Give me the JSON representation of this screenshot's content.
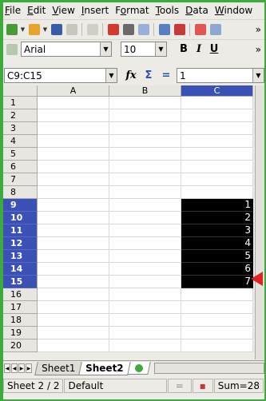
{
  "menubar": {
    "items": [
      "File",
      "Edit",
      "View",
      "Insert",
      "Format",
      "Tools",
      "Data",
      "Window"
    ],
    "mnemonics": [
      "F",
      "E",
      "V",
      "I",
      "o",
      "T",
      "D",
      "W"
    ]
  },
  "toolbar1": {
    "icons": [
      "new-document-icon",
      "open-folder-icon",
      "save-icon",
      "email-icon",
      "edit-file-icon",
      "export-pdf-icon",
      "print-icon",
      "page-preview-icon",
      "spellcheck-icon",
      "autospellcheck-icon",
      "cut-icon",
      "copy-icon"
    ],
    "overflow": "»"
  },
  "toolbar2": {
    "font_name": "Arial",
    "font_size": "10",
    "bold": "B",
    "italic": "I",
    "underline": "U",
    "overflow": "»"
  },
  "formula": {
    "cell_ref": "C9:C15",
    "fx": "fx",
    "sum": "Σ",
    "equals": "=",
    "value": "1"
  },
  "columns": [
    "A",
    "B",
    "C"
  ],
  "rows": [
    "1",
    "2",
    "3",
    "4",
    "5",
    "6",
    "7",
    "8",
    "9",
    "10",
    "11",
    "12",
    "13",
    "14",
    "15",
    "16",
    "17",
    "18",
    "19",
    "20"
  ],
  "selected_rows": [
    "9",
    "10",
    "11",
    "12",
    "13",
    "14",
    "15"
  ],
  "cells_c": {
    "9": "1",
    "10": "2",
    "11": "3",
    "12": "4",
    "13": "5",
    "14": "6",
    "15": "7"
  },
  "sheet_tabs": [
    "Sheet1",
    "Sheet2"
  ],
  "active_tab": "Sheet2",
  "status": {
    "sheet": "Sheet 2 / 2",
    "style": "Default",
    "sum": "Sum=28"
  },
  "colors": {
    "selection_header": "#3c51b5",
    "selection_fill": "#000000",
    "desktop": "#3cab3c"
  }
}
